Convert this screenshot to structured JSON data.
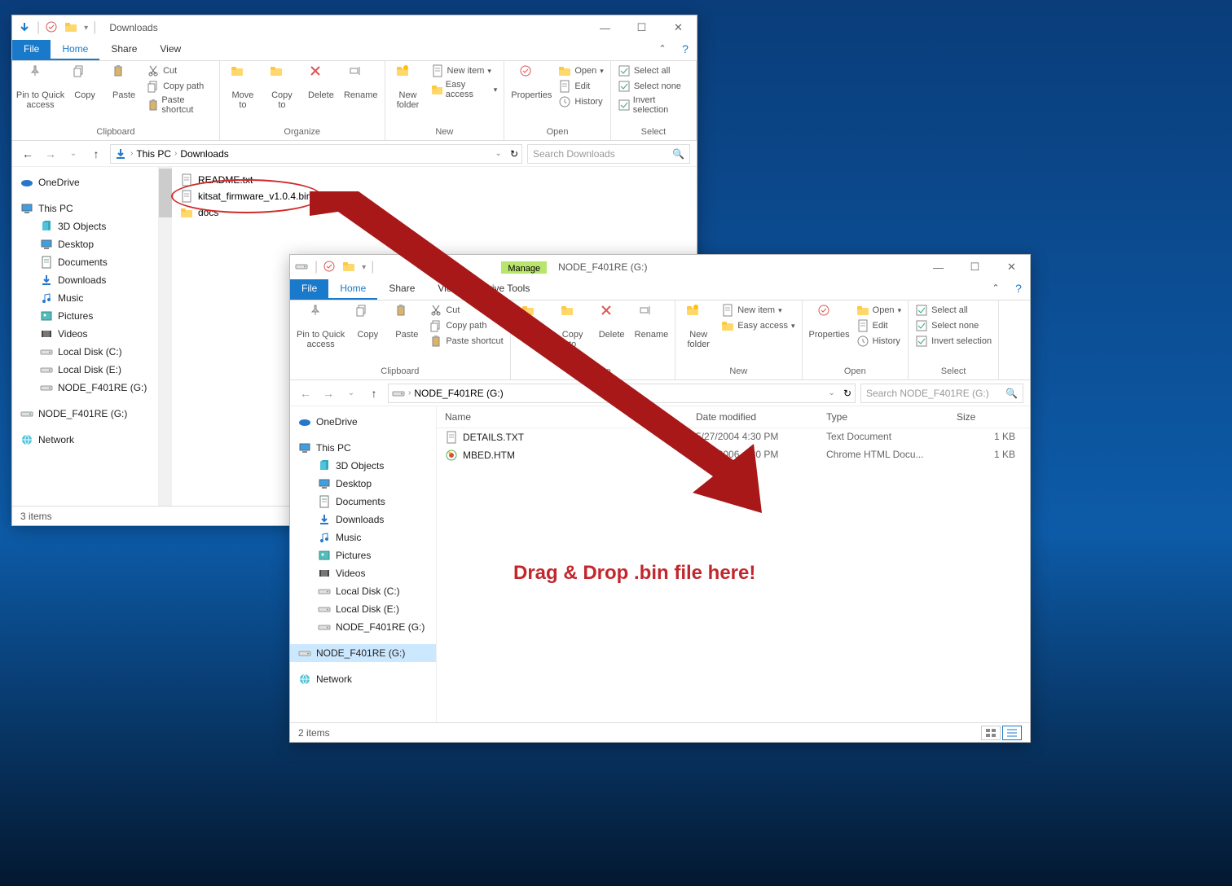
{
  "annotation_text": "Drag & Drop .bin file here!",
  "win1": {
    "title": "Downloads",
    "tabs": {
      "file": "File",
      "home": "Home",
      "share": "Share",
      "view": "View"
    },
    "ribbon": {
      "clipboard": {
        "pin": "Pin to Quick\naccess",
        "copy": "Copy",
        "paste": "Paste",
        "cut": "Cut",
        "copypath": "Copy path",
        "pasteshort": "Paste shortcut",
        "label": "Clipboard"
      },
      "organize": {
        "moveto": "Move\nto",
        "copyto": "Copy\nto",
        "delete": "Delete",
        "rename": "Rename",
        "label": "Organize"
      },
      "new": {
        "newfolder": "New\nfolder",
        "newitem": "New item",
        "easyaccess": "Easy access",
        "label": "New"
      },
      "open": {
        "properties": "Properties",
        "open": "Open",
        "edit": "Edit",
        "history": "History",
        "label": "Open"
      },
      "select": {
        "selectall": "Select all",
        "selectnone": "Select none",
        "invert": "Invert selection",
        "label": "Select"
      }
    },
    "breadcrumb": [
      "This PC",
      "Downloads"
    ],
    "search_placeholder": "Search Downloads",
    "nav": {
      "onedrive": "OneDrive",
      "thispc": "This PC",
      "items": [
        "3D Objects",
        "Desktop",
        "Documents",
        "Downloads",
        "Music",
        "Pictures",
        "Videos",
        "Local Disk (C:)",
        "Local Disk (E:)",
        "NODE_F401RE (G:)"
      ],
      "node_repeat": "NODE_F401RE (G:)",
      "network": "Network"
    },
    "files": [
      {
        "name": "README.txt",
        "type": "txt"
      },
      {
        "name": "kitsat_firmware_v1.0.4.bin",
        "type": "bin"
      },
      {
        "name": "docs",
        "type": "folder"
      }
    ],
    "status": "3 items"
  },
  "win2": {
    "context": "Manage",
    "context_sub": "Drive Tools",
    "title": "NODE_F401RE (G:)",
    "tabs": {
      "file": "File",
      "home": "Home",
      "share": "Share",
      "view": "View"
    },
    "ribbon": {
      "clipboard": {
        "pin": "Pin to Quick\naccess",
        "copy": "Copy",
        "paste": "Paste",
        "cut": "Cut",
        "copypath": "Copy path",
        "pasteshort": "Paste shortcut",
        "label": "Clipboard"
      },
      "organize": {
        "moveto": "Move\nto",
        "copyto": "Copy\nto",
        "delete": "Delete",
        "rename": "Rename",
        "label": "Organize"
      },
      "new": {
        "newfolder": "New\nfolder",
        "newitem": "New item",
        "easyaccess": "Easy access",
        "label": "New"
      },
      "open": {
        "properties": "Properties",
        "open": "Open",
        "edit": "Edit",
        "history": "History",
        "label": "Open"
      },
      "select": {
        "selectall": "Select all",
        "selectnone": "Select none",
        "invert": "Invert selection",
        "label": "Select"
      }
    },
    "breadcrumb": [
      "NODE_F401RE (G:)"
    ],
    "search_placeholder": "Search NODE_F401RE (G:)",
    "columns": {
      "name": "Name",
      "date": "Date modified",
      "type": "Type",
      "size": "Size"
    },
    "nav": {
      "onedrive": "OneDrive",
      "thispc": "This PC",
      "items": [
        "3D Objects",
        "Desktop",
        "Documents",
        "Downloads",
        "Music",
        "Pictures",
        "Videos",
        "Local Disk (C:)",
        "Local Disk (E:)",
        "NODE_F401RE (G:)"
      ],
      "node_repeat": "NODE_F401RE (G:)",
      "network": "Network"
    },
    "files": [
      {
        "name": "DETAILS.TXT",
        "date": "5/27/2004 4:30 PM",
        "type": "Text Document",
        "size": "1 KB",
        "icon": "txt"
      },
      {
        "name": "MBED.HTM",
        "date": "5/27/2006 4:30 PM",
        "type": "Chrome HTML Docu...",
        "size": "1 KB",
        "icon": "htm"
      }
    ],
    "status": "2 items"
  }
}
